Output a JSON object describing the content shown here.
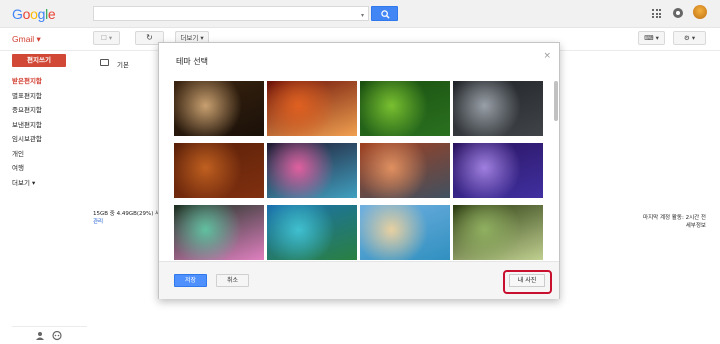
{
  "header": {
    "logo": [
      "G",
      "o",
      "o",
      "g",
      "l",
      "e"
    ],
    "logo_colors": [
      "#4285f4",
      "#ea4335",
      "#fbbc05",
      "#4285f4",
      "#34a853",
      "#ea4335"
    ],
    "search": {
      "value": "",
      "placeholder": ""
    }
  },
  "toolbar": {
    "gmail_label": "Gmail ▾",
    "checkbox_drop": "☐ ▾",
    "refresh": "↻",
    "more_label": "더보기 ▾",
    "keyboard_drop": "⌨ ▾",
    "settings_drop": "⚙ ▾"
  },
  "sidebar": {
    "compose_label": "편지쓰기",
    "items": [
      {
        "label": "받은편지함",
        "active": true
      },
      {
        "label": "별표편지함",
        "active": false
      },
      {
        "label": "중요편지함",
        "active": false
      },
      {
        "label": "보낸편지함",
        "active": false
      },
      {
        "label": "임시보관함",
        "active": false
      },
      {
        "label": "개인",
        "active": false
      },
      {
        "label": "여행",
        "active": false
      },
      {
        "label": "더보기 ▾",
        "active": false
      }
    ]
  },
  "main": {
    "tab_label": "기본",
    "storage_text": "15GB 중 4.49GB(29%) 사",
    "storage_link": "관리",
    "activity_line1": "마지막 계정 활동: 2시간 전",
    "activity_line2": "세부정보"
  },
  "dialog": {
    "title": "테마 선택",
    "close": "×",
    "themes": [
      {
        "name": "chess-pieces",
        "colors": [
          "#3a2410",
          "#c8a070",
          "#1a1008"
        ]
      },
      {
        "name": "red-canyon",
        "colors": [
          "#6a1008",
          "#e06020",
          "#f0a050"
        ]
      },
      {
        "name": "green-caterpillar",
        "colors": [
          "#1a5010",
          "#7ac030",
          "#2a7020"
        ]
      },
      {
        "name": "metal-pipes",
        "colors": [
          "#202428",
          "#9aa0a8",
          "#404448"
        ]
      },
      {
        "name": "autumn-leaves",
        "colors": [
          "#5a2008",
          "#c06020",
          "#803010"
        ]
      },
      {
        "name": "colorful-bokeh",
        "colors": [
          "#201830",
          "#e060a0",
          "#40a0c0"
        ]
      },
      {
        "name": "river-canyon",
        "colors": [
          "#a04020",
          "#e09060",
          "#405060"
        ]
      },
      {
        "name": "jellyfish",
        "colors": [
          "#2a1460",
          "#a080e0",
          "#4030a0"
        ]
      },
      {
        "name": "rainbow-light",
        "colors": [
          "#1a3020",
          "#60c0a0",
          "#e080c0"
        ]
      },
      {
        "name": "tropical-lake",
        "colors": [
          "#1a70b0",
          "#40c0d0",
          "#2a8040"
        ]
      },
      {
        "name": "beach-walk",
        "colors": [
          "#70b0e0",
          "#e8d0a0",
          "#3090c0"
        ]
      },
      {
        "name": "forest-path",
        "colors": [
          "#2a3a10",
          "#90b060",
          "#c0d090"
        ]
      }
    ],
    "save_label": "저장",
    "cancel_label": "취소",
    "my_photo_label": "내 사진"
  }
}
